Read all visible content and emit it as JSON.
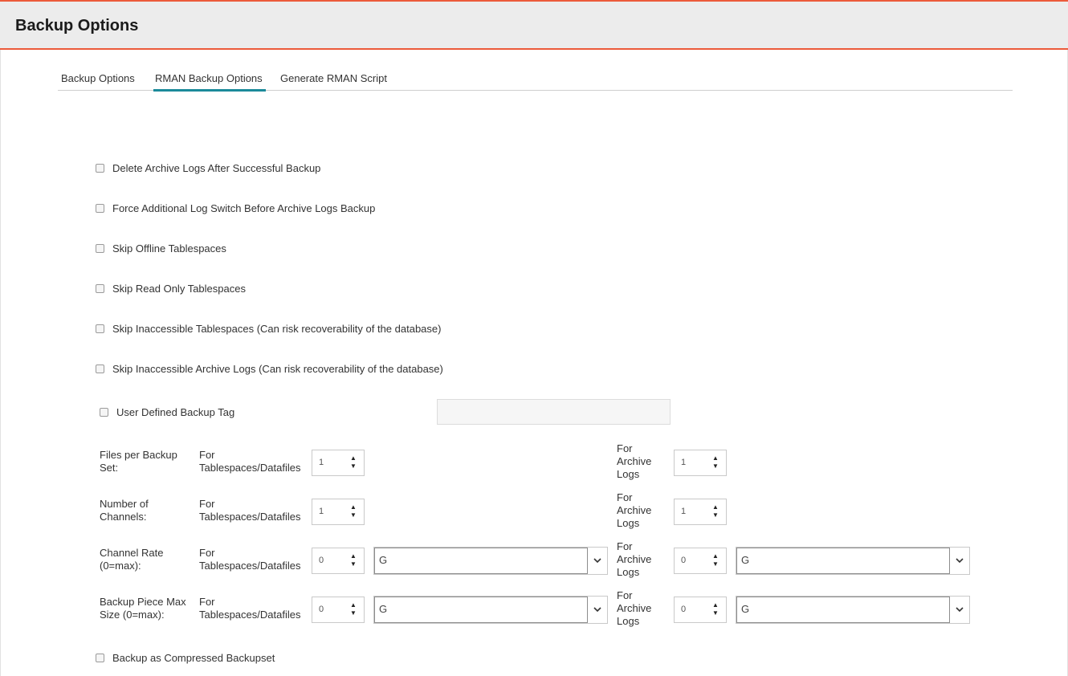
{
  "header": {
    "title": "Backup Options"
  },
  "tabs": [
    {
      "label": "Backup Options",
      "active": false
    },
    {
      "label": "RMAN Backup Options",
      "active": true
    },
    {
      "label": "Generate RMAN Script",
      "active": false
    }
  ],
  "checkboxes": {
    "delete_archive_logs": {
      "label": "Delete Archive Logs After Successful Backup",
      "checked": false
    },
    "force_log_switch": {
      "label": "Force Additional Log Switch Before Archive Logs Backup",
      "checked": false
    },
    "skip_offline": {
      "label": "Skip Offline Tablespaces",
      "checked": false
    },
    "skip_read_only": {
      "label": "Skip Read Only Tablespaces",
      "checked": false
    },
    "skip_inaccessible_ts": {
      "label": "Skip Inaccessible Tablespaces (Can risk recoverability of the database)",
      "checked": false
    },
    "skip_inaccessible_logs": {
      "label": "Skip Inaccessible Archive Logs (Can risk recoverability of the database)",
      "checked": false
    },
    "user_defined_tag": {
      "label": "User Defined Backup Tag",
      "checked": false,
      "value": ""
    },
    "compressed_backupset": {
      "label": "Backup as Compressed Backupset",
      "checked": false
    }
  },
  "sub_labels": {
    "tablespaces_for": "For",
    "tablespaces_target": "Tablespaces/Datafiles",
    "archive_for": "For",
    "archive_mid": "Archive",
    "archive_logs": "Logs"
  },
  "rows": {
    "files_per_set": {
      "label_line1": "Files per Backup",
      "label_line2": "Set:",
      "ts_value": "1",
      "arch_value": "1"
    },
    "channels": {
      "label_line1": "Number of",
      "label_line2": "Channels:",
      "ts_value": "1",
      "arch_value": "1"
    },
    "channel_rate": {
      "label_line1": "Channel Rate",
      "label_line2": "(0=max):",
      "ts_value": "0",
      "ts_unit": "G",
      "arch_value": "0",
      "arch_unit": "G"
    },
    "piece_max": {
      "label_line1": "Backup Piece Max",
      "label_line2": "Size (0=max):",
      "ts_value": "0",
      "ts_unit": "G",
      "arch_value": "0",
      "arch_unit": "G"
    }
  }
}
